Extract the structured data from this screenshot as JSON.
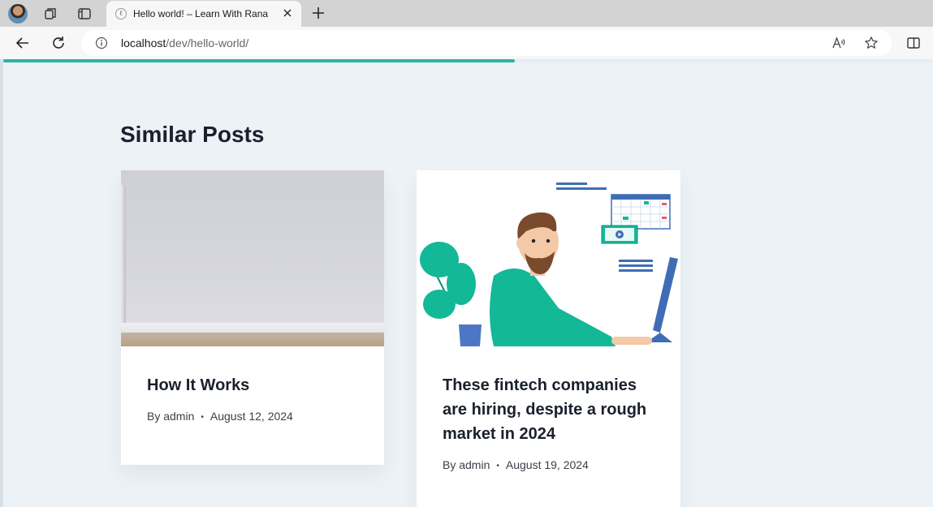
{
  "browser": {
    "tab_title": "Hello world! – Learn With Rana",
    "url_host": "localhost",
    "url_path": "/dev/hello-world/",
    "favicon_letter": "ℓ",
    "reading_progress_percent": 55
  },
  "page": {
    "section_title": "Similar Posts"
  },
  "posts": [
    {
      "title": "How It Works",
      "author": "By admin",
      "date": "August 12, 2024"
    },
    {
      "title_lines": [
        "These fintech companies",
        "are hiring, despite a rough",
        "market in 2024"
      ],
      "author": "By admin",
      "date": "August 19, 2024"
    }
  ],
  "colors": {
    "accent": "#2bb3a8",
    "page_bg": "#edf2f7",
    "illustration_green": "#13b897",
    "illustration_blue": "#3f6db5"
  }
}
